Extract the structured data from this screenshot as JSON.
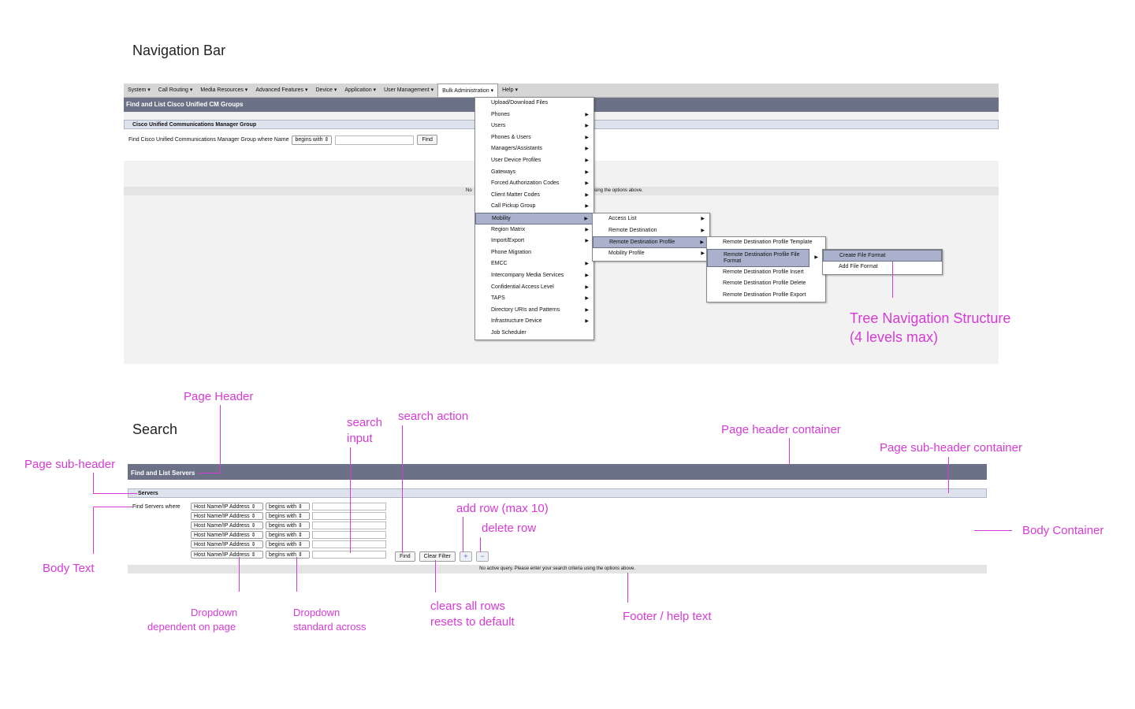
{
  "nav_section": {
    "title": "Navigation Bar",
    "menubar": [
      "System ▾",
      "Call Routing ▾",
      "Media Resources ▾",
      "Advanced Features ▾",
      "Device ▾",
      "Application ▾",
      "User Management ▾",
      "Bulk Administration ▾",
      "Help ▾"
    ],
    "page_title": "Find and List Cisco Unified CM Groups",
    "sub_header": "Cisco Unified Communications Manager Group",
    "find_label": "Find Cisco Unified Communications Manager Group where Name",
    "find_select": "begins with ⇕",
    "find_button": "Find",
    "status_left": "No",
    "status_right": "sing the options above.",
    "menu_level1": [
      "Upload/Download Files",
      "Phones",
      "Users",
      "Phones & Users",
      "Managers/Assistants",
      "User Device Profiles",
      "Gateways",
      "Forced Authorization Codes",
      "Client Matter Codes",
      "Call Pickup Group",
      "Mobility",
      "Region Matrix",
      "Import/Export",
      "Phone Migration",
      "EMCC",
      "Intercompany Media Services",
      "Confidential Access Level",
      "TAPS",
      "Directory URIs and Patterns",
      "Infrastructure Device",
      "Job Scheduler"
    ],
    "menu_level2": [
      "Access List",
      "Remote Destination",
      "Remote Destination Profile",
      "Mobility Profile"
    ],
    "menu_level3": [
      "Remote Destination Profile Template",
      "Remote Destination Profile File Format",
      "Remote Destination Profile Insert",
      "Remote Destination Profile Delete",
      "Remote Destination Profile Export"
    ],
    "menu_level4": [
      "Create File Format",
      "Add File Format"
    ],
    "tree_note_line1": "Tree Navigation Structure",
    "tree_note_line2": "(4 levels max)"
  },
  "search_section": {
    "title": "Search",
    "page_title": "Find and List Servers",
    "sub_header": "Servers",
    "find_label": "Find Servers where",
    "field_select": "Host Name/IP Address ⇕",
    "op_select": "begins with ⇕",
    "find_button": "Find",
    "clear_button": "Clear Filter",
    "add_button": "+",
    "delete_button": "−",
    "status": "No active query. Please enter your search criteria using the options above."
  },
  "annotations": {
    "page_header": "Page Header",
    "page_subheader": "Page sub-header",
    "search_input_1": "search",
    "search_input_2": "input",
    "search_action": "search action",
    "page_header_container": "Page header container",
    "page_subheader_container": "Page sub-header container",
    "add_row": "add row (max 10)",
    "delete_row": "delete row",
    "body_container": "Body Container",
    "body_text": "Body Text",
    "dropdown_dep_1": "Dropdown",
    "dropdown_dep_2": "dependent on page",
    "dropdown_std_1": "Dropdown",
    "dropdown_std_2": "standard across",
    "clears_1": "clears all rows",
    "clears_2": "resets to default",
    "footer": "Footer / help text"
  }
}
